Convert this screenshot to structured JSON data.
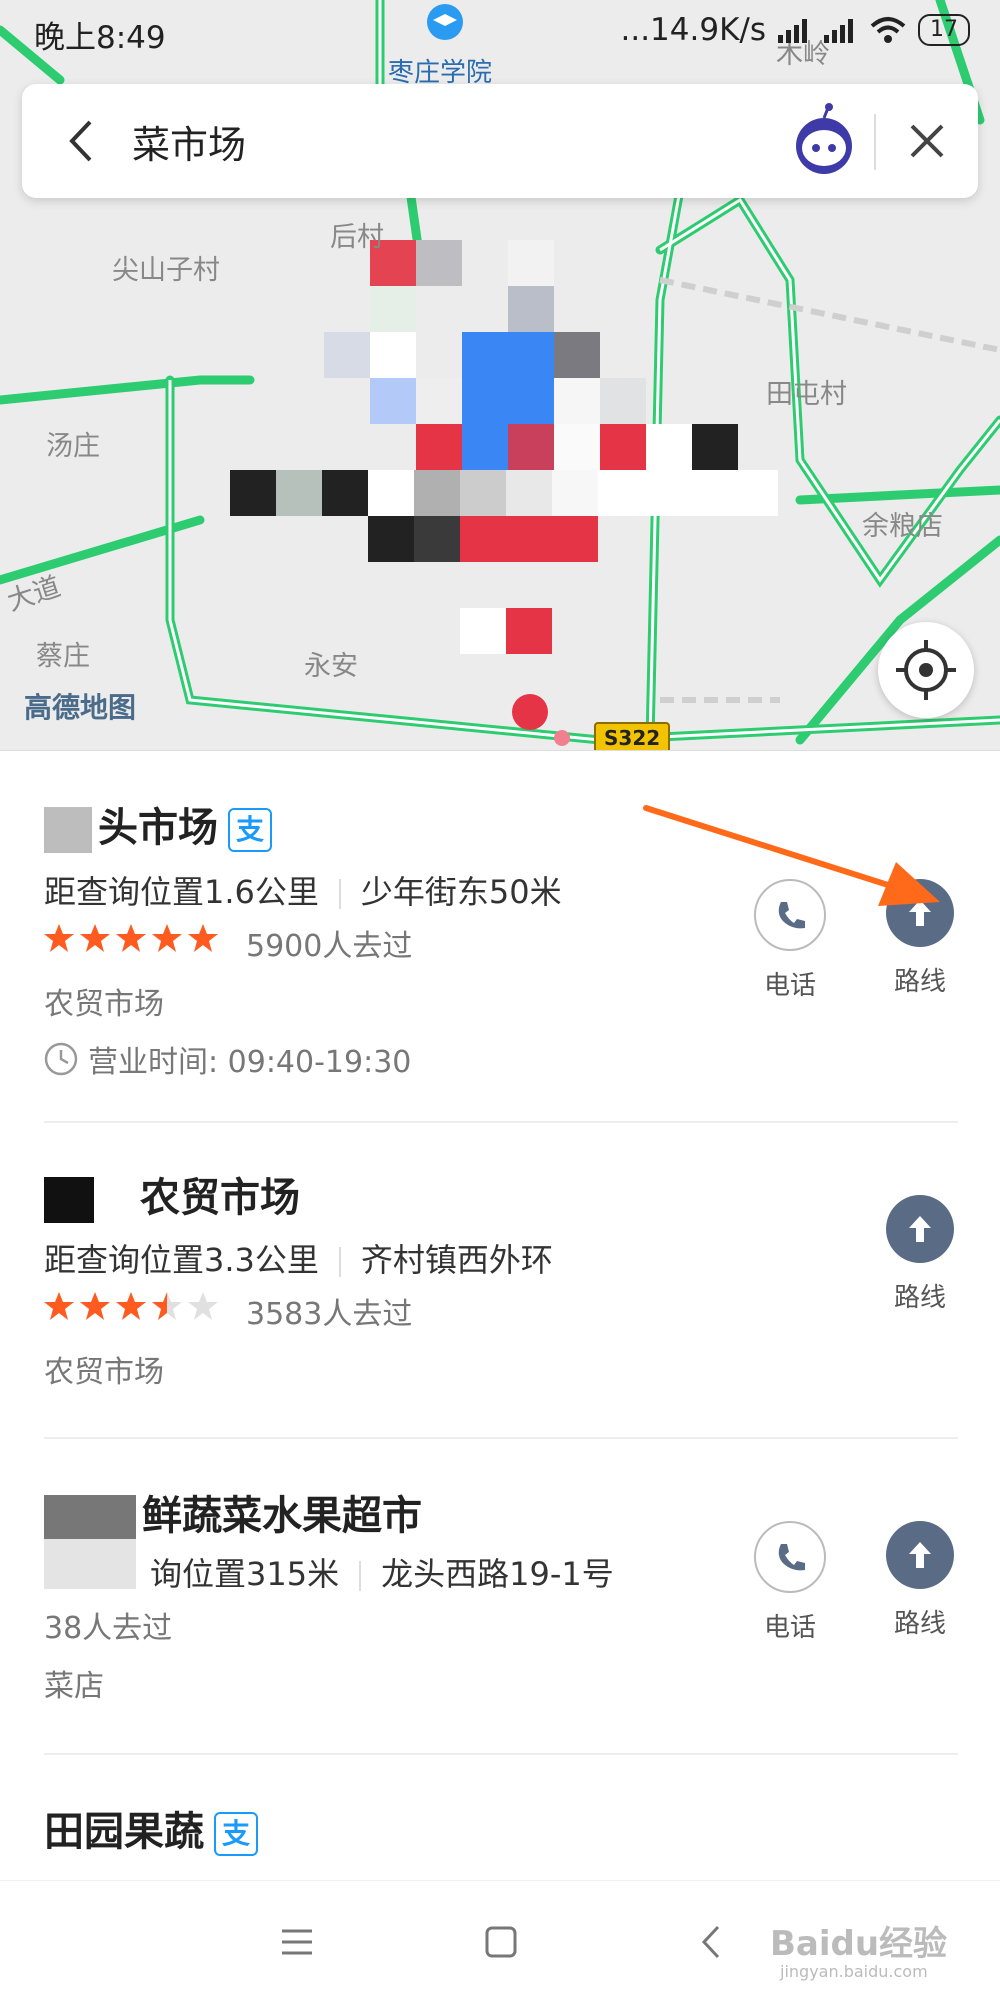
{
  "status_bar": {
    "time": "晚上8:49",
    "network": "...14.9K/s",
    "battery": "17"
  },
  "search": {
    "query": "菜市场"
  },
  "map": {
    "labels": [
      "枣庄学院",
      "后村",
      "尖山子村",
      "汤庄",
      "田屯村",
      "余粮店",
      "蔡庄",
      "永安",
      "大道",
      "木岭"
    ],
    "logo": "高德地图",
    "road_badge": "S322"
  },
  "results": [
    {
      "title": "头市场",
      "alipay": "支",
      "distance": "距查询位置1.6公里",
      "address": "少年街东50米",
      "rating": 5,
      "visits": "5900人去过",
      "category": "农贸市场",
      "hours": "营业时间: 09:40-19:30",
      "phone_label": "电话",
      "route_label": "路线"
    },
    {
      "title": "农贸市场",
      "distance": "距查询位置3.3公里",
      "address": "齐村镇西外环",
      "rating": 3.5,
      "visits": "3583人去过",
      "category": "农贸市场",
      "route_label": "路线"
    },
    {
      "title": "鲜蔬菜水果超市",
      "distance": "询位置315米",
      "address": "龙头西路19-1号",
      "visits": "38人去过",
      "category": "菜店",
      "phone_label": "电话",
      "route_label": "路线"
    },
    {
      "title": "田园果蔬",
      "alipay": "支"
    }
  ],
  "watermark": {
    "brand": "Baidu经验",
    "url": "jingyan.baidu.com"
  },
  "colors": {
    "road_green": "#2ecc71",
    "route_button": "#5a6b85",
    "star": "#ff5a1f",
    "alipay": "#1a9bfc",
    "annotation_arrow": "#ff6a1a"
  }
}
